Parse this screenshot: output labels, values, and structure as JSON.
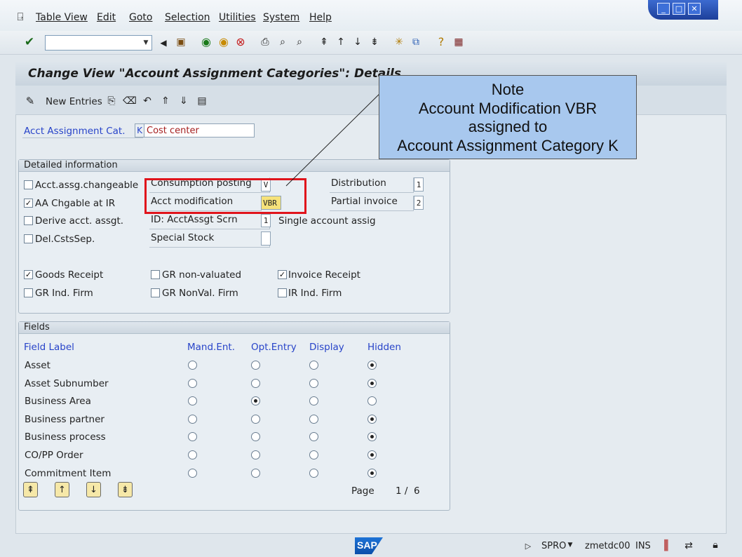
{
  "menu": [
    "Table View",
    "Edit",
    "Goto",
    "Selection",
    "Utilities",
    "System",
    "Help"
  ],
  "toolbar": {
    "command_value": ""
  },
  "title": "Change View \"Account Assignment Categories\": Details",
  "app_toolbar": {
    "new_entries": "New Entries"
  },
  "header": {
    "label": "Acct Assignment Cat.",
    "code": "K",
    "name": "Cost center"
  },
  "detailed": {
    "title": "Detailed information",
    "acct_assg_changeable": {
      "label": "Acct.assg.changeable",
      "checked": false
    },
    "aa_chgable_at_ir": {
      "label": "AA Chgable at IR",
      "checked": true
    },
    "derive_acct": {
      "label": "Derive acct. assgt.",
      "checked": false
    },
    "del_csts": {
      "label": "Del.CstsSep.",
      "checked": false
    },
    "consumption_posting": {
      "label": "Consumption posting",
      "value": "V"
    },
    "acct_modification": {
      "label": "Acct modification",
      "value": "VBR"
    },
    "id_acctassgt_scrn": {
      "label": "ID: AcctAssgt Scrn",
      "value": "1",
      "text": "Single account assig"
    },
    "special_stock": {
      "label": "Special Stock",
      "value": ""
    },
    "distribution": {
      "label": "Distribution",
      "value": "1"
    },
    "partial_invoice": {
      "label": "Partial invoice",
      "value": "2"
    },
    "goods_receipt": {
      "label": "Goods Receipt",
      "checked": true
    },
    "gr_ind_firm": {
      "label": "GR Ind. Firm",
      "checked": false
    },
    "gr_non_valuated": {
      "label": "GR non-valuated",
      "checked": false
    },
    "gr_nonval_firm": {
      "label": "GR NonVal. Firm",
      "checked": false
    },
    "invoice_receipt": {
      "label": "Invoice Receipt",
      "checked": true
    },
    "ir_ind_firm": {
      "label": "IR Ind. Firm",
      "checked": false
    }
  },
  "fields": {
    "title": "Fields",
    "columns": [
      "Field Label",
      "Mand.Ent.",
      "Opt.Entry",
      "Display",
      "Hidden"
    ],
    "rows": [
      {
        "label": "Asset",
        "selected": "Hidden"
      },
      {
        "label": "Asset Subnumber",
        "selected": "Hidden"
      },
      {
        "label": "Business Area",
        "selected": "Opt.Entry"
      },
      {
        "label": "Business partner",
        "selected": "Hidden"
      },
      {
        "label": "Business process",
        "selected": "Hidden"
      },
      {
        "label": "CO/PP Order",
        "selected": "Hidden"
      },
      {
        "label": "Commitment Item",
        "selected": "Hidden"
      }
    ],
    "page_label": "Page",
    "page_value": "1 /  6"
  },
  "note": {
    "line1": "Note",
    "line2": "Account Modification VBR",
    "line3": "assigned to",
    "line4": "Account Assignment Category K"
  },
  "status": {
    "logo": "SAP",
    "transaction": "SPRO",
    "server": "zmetdc00",
    "mode": "INS"
  }
}
